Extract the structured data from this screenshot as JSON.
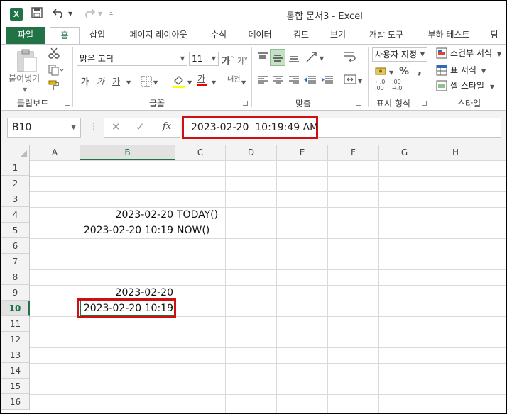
{
  "window": {
    "title": "통합 문서3 - Excel",
    "app_logo": "X"
  },
  "quick_access": {
    "save_icon": "save-icon",
    "undo_icon": "undo-icon",
    "redo_icon": "redo-icon",
    "customize_icon": "customize-icon"
  },
  "tabs": [
    "파일",
    "홈",
    "삽입",
    "페이지 레이아웃",
    "수식",
    "데이터",
    "검토",
    "보기",
    "개발 도구",
    "부하 테스트",
    "팀"
  ],
  "active_tab": "홈",
  "ribbon": {
    "clipboard": {
      "paste_label": "붙여넣기",
      "group_label": "클립보드"
    },
    "font": {
      "font_name": "맑은 고딕",
      "font_size": "11",
      "grow_label": "가",
      "shrink_label": "가",
      "bold": "가",
      "italic": "가",
      "underline": "가",
      "fill_icon": "fill-color-icon",
      "font_color_label": "가",
      "phonetic_label": "내천",
      "group_label": "글꼴"
    },
    "alignment": {
      "group_label": "맞춤"
    },
    "number": {
      "format": "사용자 지정",
      "percent": "%",
      "comma": ",",
      "group_label": "표시 형식"
    },
    "styles": {
      "conditional": "조건부 서식",
      "table": "표 서식",
      "cell_style": "셀 스타일",
      "group_label": "스타일"
    }
  },
  "formula_bar": {
    "name_box": "B10",
    "cancel": "✕",
    "enter": "✓",
    "fx": "fx",
    "formula": "2023-02-20  10:19:49 AM"
  },
  "columns": [
    "A",
    "B",
    "C",
    "D",
    "E",
    "F",
    "G",
    "H"
  ],
  "rows": [
    "1",
    "2",
    "3",
    "4",
    "5",
    "6",
    "7",
    "8",
    "9",
    "10",
    "11",
    "12",
    "13",
    "14",
    "15",
    "16"
  ],
  "selected": {
    "column": "B",
    "row": "10"
  },
  "cells": {
    "B4": "2023-02-20",
    "C4": "TODAY()",
    "B5": "2023-02-20 10:19",
    "C5": "NOW()",
    "B9": "2023-02-20",
    "B10": "2023-02-20 10:19"
  }
}
